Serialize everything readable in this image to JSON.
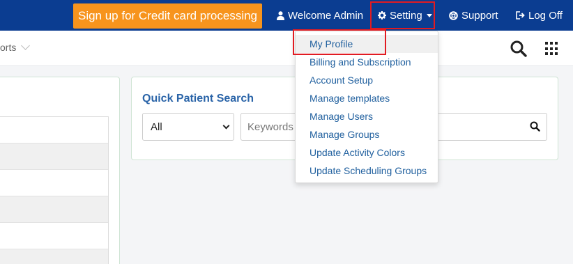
{
  "topnav": {
    "signup_label": "Sign up for Credit card processing",
    "welcome_label": "Welcome Admin",
    "setting_label": "Setting",
    "support_label": "Support",
    "logoff_label": "Log Off",
    "colors": {
      "nav_bg": "#0b3d91",
      "cta_bg": "#f7941d",
      "highlight": "#e11b22"
    }
  },
  "subbar": {
    "reports_label": "orts",
    "icons": [
      "search-icon",
      "apps-grid-icon",
      "chevron-down-icon"
    ]
  },
  "quick_search": {
    "title": "Quick Patient Search",
    "filter_value": "All",
    "keywords_placeholder": "Keywords"
  },
  "settings_menu": {
    "items": [
      "My Profile",
      "Billing and Subscription",
      "Account Setup",
      "Manage templates",
      "Manage Users",
      "Manage Groups",
      "Update Activity Colors",
      "Update Scheduling Groups"
    ],
    "active_item": "My Profile"
  }
}
